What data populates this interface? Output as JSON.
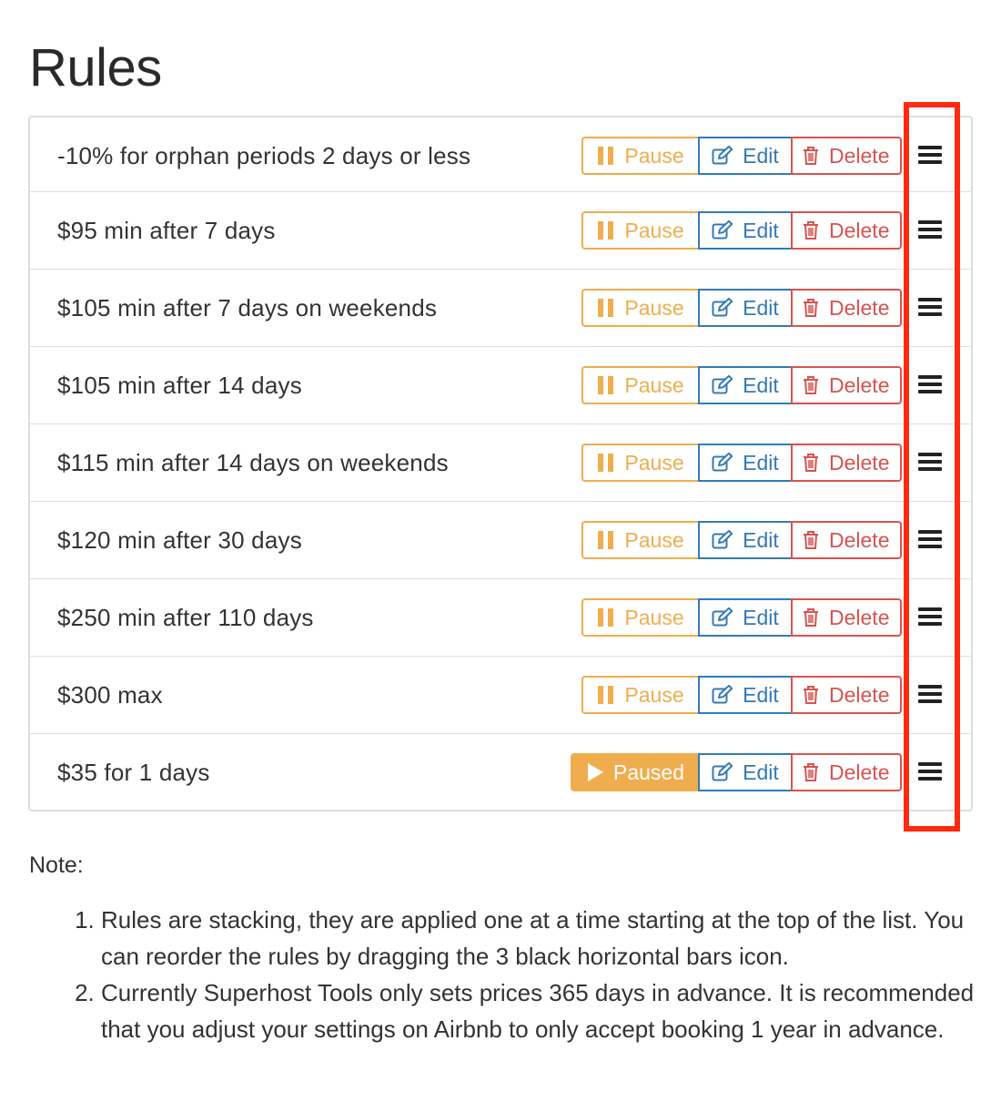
{
  "page": {
    "title": "Rules"
  },
  "buttons": {
    "pause": "Pause",
    "paused": "Paused",
    "edit": "Edit",
    "delete": "Delete"
  },
  "rules": [
    {
      "label": "-10% for orphan periods 2 days or less",
      "paused": false
    },
    {
      "label": "$95 min after 7 days",
      "paused": false
    },
    {
      "label": "$105 min after 7 days on weekends",
      "paused": false
    },
    {
      "label": "$105 min after 14 days",
      "paused": false
    },
    {
      "label": "$115 min after 14 days on weekends",
      "paused": false
    },
    {
      "label": "$120 min after 30 days",
      "paused": false
    },
    {
      "label": "$250 min after 110 days",
      "paused": false
    },
    {
      "label": "$300 max",
      "paused": false
    },
    {
      "label": "$35 for 1 days",
      "paused": true
    }
  ],
  "note": {
    "heading": "Note:",
    "items": [
      "Rules are stacking, they are applied one at a time starting at the top of the list. You can reorder the rules by dragging the 3 black horizontal bars icon.",
      "Currently Superhost Tools only sets prices 365 days in advance. It is recommended that you adjust your settings on Airbnb to only accept booking 1 year in advance."
    ]
  },
  "colors": {
    "pause": "#f0ad4e",
    "edit": "#337ab7",
    "delete": "#d9534f",
    "highlight": "#ff2a10"
  },
  "icons": {
    "pause": "pause-icon",
    "play": "play-icon",
    "edit": "edit-icon",
    "delete": "trash-icon",
    "drag": "drag-handle-icon"
  }
}
